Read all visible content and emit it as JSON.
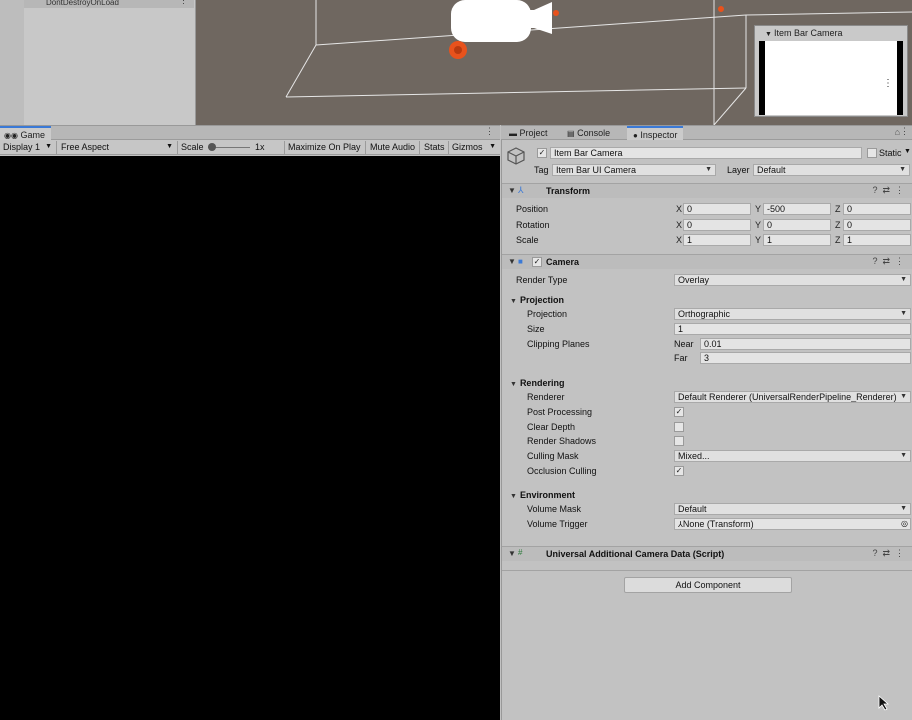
{
  "hierarchy": {
    "partial_item": "DontDestroyOnLoad"
  },
  "camera_preview": {
    "title": "Item Bar Camera"
  },
  "game_panel": {
    "tab_label": "Game",
    "display": "Display 1",
    "aspect": "Free Aspect",
    "scale_label": "Scale",
    "scale_value": "1x",
    "maximize_on_play": "Maximize On Play",
    "mute_audio": "Mute Audio",
    "stats": "Stats",
    "gizmos": "Gizmos"
  },
  "inspector_tabs": {
    "project": "Project",
    "console": "Console",
    "inspector": "Inspector"
  },
  "object": {
    "name": "Item Bar Camera",
    "static_label": "Static",
    "tag_label": "Tag",
    "tag_value": "Item Bar UI Camera",
    "layer_label": "Layer",
    "layer_value": "Default"
  },
  "transform": {
    "title": "Transform",
    "position_label": "Position",
    "rotation_label": "Rotation",
    "scale_label": "Scale",
    "position": {
      "x": "0",
      "y": "-500",
      "z": "0"
    },
    "rotation": {
      "x": "0",
      "y": "0",
      "z": "0"
    },
    "scale": {
      "x": "1",
      "y": "1",
      "z": "1"
    },
    "axes": {
      "x": "X",
      "y": "Y",
      "z": "Z"
    }
  },
  "camera": {
    "title": "Camera",
    "render_type_label": "Render Type",
    "render_type": "Overlay",
    "projection_section": "Projection",
    "projection_label": "Projection",
    "projection": "Orthographic",
    "size_label": "Size",
    "size": "1",
    "clipping_label": "Clipping Planes",
    "near_label": "Near",
    "near": "0.01",
    "far_label": "Far",
    "far": "3",
    "rendering_section": "Rendering",
    "renderer_label": "Renderer",
    "renderer": "Default Renderer (UniversalRenderPipeline_Renderer)",
    "post_processing_label": "Post Processing",
    "post_processing": true,
    "clear_depth_label": "Clear Depth",
    "clear_depth": false,
    "render_shadows_label": "Render Shadows",
    "render_shadows": false,
    "culling_mask_label": "Culling Mask",
    "culling_mask": "Mixed...",
    "occlusion_culling_label": "Occlusion Culling",
    "occlusion_culling": true,
    "environment_section": "Environment",
    "volume_mask_label": "Volume Mask",
    "volume_mask": "Default",
    "volume_trigger_label": "Volume Trigger",
    "volume_trigger": "None (Transform)"
  },
  "additional_data": {
    "title": "Universal Additional Camera Data (Script)"
  },
  "add_component": "Add Component",
  "colors": {
    "accent": "#3a79d6",
    "panel": "#c2c2c2",
    "scene": "#6f6760",
    "game": "#000000",
    "camera_icon": "#e8521c"
  },
  "icons": [
    "gameobject-cube-icon",
    "transform-icon",
    "camera-icon",
    "script-icon",
    "help-icon",
    "preset-icon",
    "kebab-icon",
    "lock-icon",
    "info-icon",
    "target-icon"
  ]
}
